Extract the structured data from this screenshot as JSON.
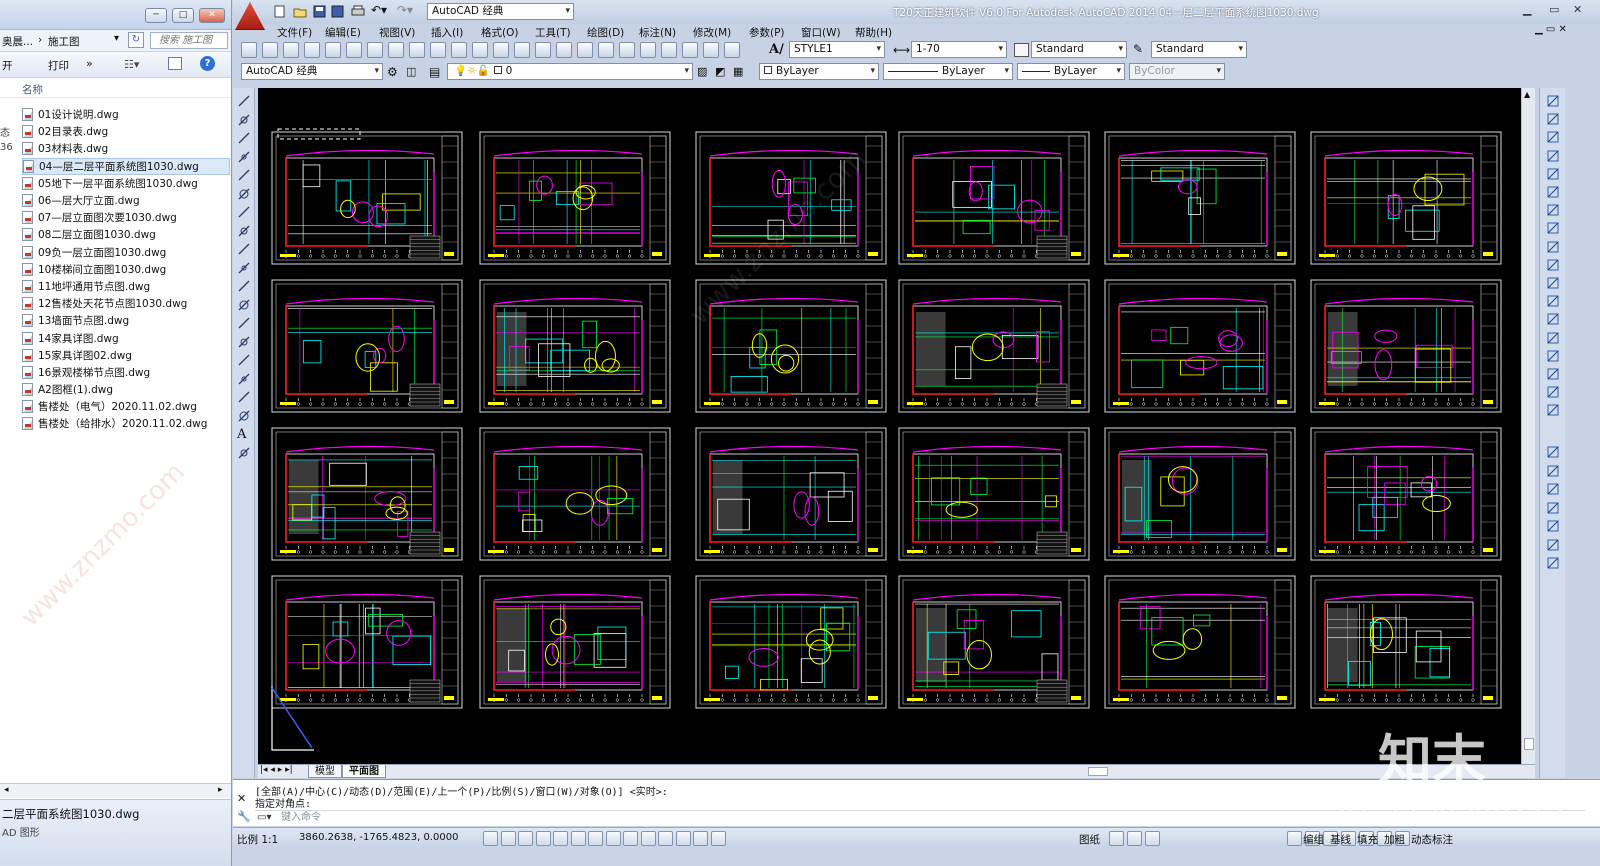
{
  "explorer": {
    "address_prefix": "奥晨...",
    "address_sep": "›",
    "address_folder": "施工图",
    "search_placeholder": "搜索 施工图",
    "cmd_open": "开",
    "cmd_print": "打印",
    "cmd_more": "»",
    "column_name": "名称",
    "files": [
      "01设计说明.dwg",
      "02目录表.dwg",
      "03材料表.dwg",
      "04—层二层平面系统图1030.dwg",
      "05地下一层平面系统图1030.dwg",
      "06—层大厅立面.dwg",
      "07—层立面图次要1030.dwg",
      "08二层立面图1030.dwg",
      "09负一层立面图1030.dwg",
      "10楼梯间立面图1030.dwg",
      "11地坪通用节点图.dwg",
      "12售楼处天花节点图1030.dwg",
      "13墙面节点图.dwg",
      "14家具详图.dwg",
      "15家具详图02.dwg",
      "16景观楼梯节点图.dwg",
      "A2图框(1).dwg",
      "售楼处（电气）2020.11.02.dwg",
      "售楼处（给排水）2020.11.02.dwg"
    ],
    "selected_index": 3,
    "details_name": "二层平面系统图1030.dwg",
    "details_type": "AD 图形",
    "left_edge_chars": [
      "态",
      "36"
    ]
  },
  "acad": {
    "title": "T20天正建筑软件 V6.0 For Autodesk AutoCAD 2014      04—层二层平面系统图1030.dwg",
    "workspace_quick": "AutoCAD 经典",
    "menus": [
      "文件(F)",
      "编辑(E)",
      "视图(V)",
      "插入(I)",
      "格式(O)",
      "工具(T)",
      "绘图(D)",
      "标注(N)",
      "修改(M)",
      "参数(P)",
      "窗口(W)",
      "帮助(H)"
    ],
    "styles": {
      "text_style": "STYLE1",
      "dim_style": "1-70",
      "table_style": "Standard",
      "mleader_style": "Standard"
    },
    "workspace": "AutoCAD 经典",
    "layer": "0",
    "color": "ByLayer",
    "linetype": "ByLayer",
    "lineweight": "ByLayer",
    "plotstyle": "ByColor",
    "tabs": [
      "模型",
      "平面图"
    ],
    "active_tab": 1,
    "cmd_line1": "[全部(A)/中心(C)/动态(D)/范围(E)/上一个(P)/比例(S)/窗口(W)/对象(O)] <实时>:",
    "cmd_line2": "指定对角点:",
    "cmd_prompt": "键入命令",
    "status": {
      "scale": "比例 1:1",
      "coords": "3860.2638,  -1765.4823,  0.0000",
      "modes": [
        "图纸",
        "编组",
        "基线",
        "填充",
        "加粗",
        "动态标注"
      ]
    }
  },
  "watermark": {
    "logo": "知末",
    "id": "ID: 1134348215",
    "site": "www.znzmo.com"
  },
  "colors": {
    "cad_bg": "#000000",
    "line_yellow": "#ffff00",
    "line_cyan": "#00ffff",
    "line_magenta": "#ff00ff",
    "line_red": "#ff2020",
    "line_white": "#ffffff",
    "line_green": "#00ff3c"
  }
}
